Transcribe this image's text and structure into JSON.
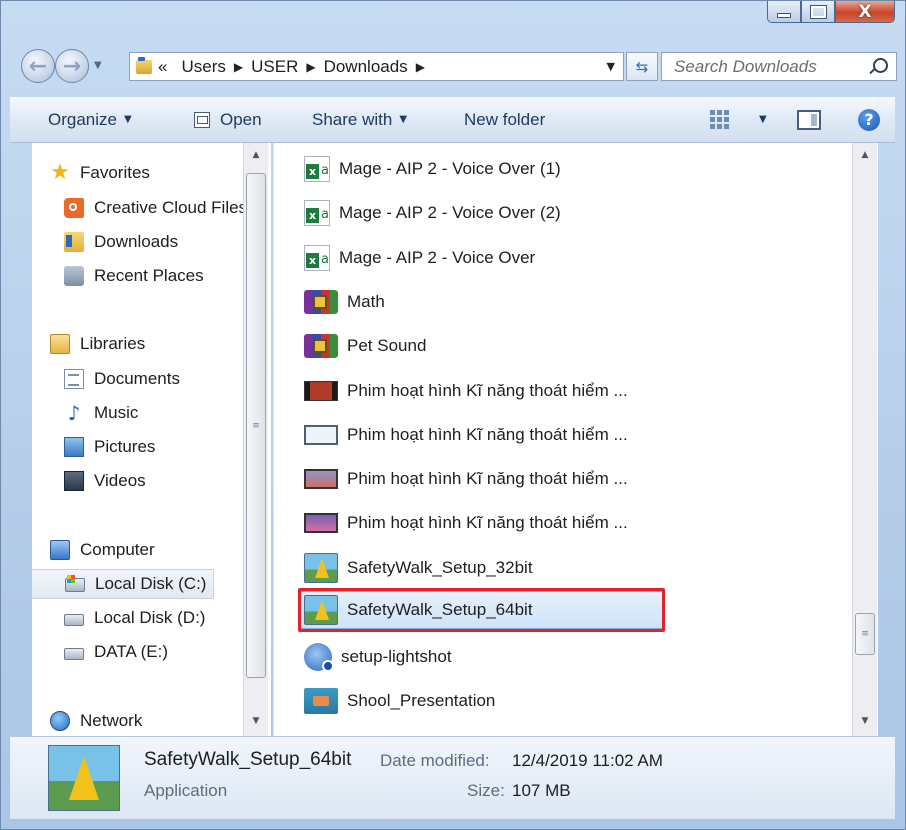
{
  "window": {
    "minimize_icon": "minimize-icon",
    "maximize_icon": "maximize-icon",
    "close_glyph": "X"
  },
  "nav": {
    "back_glyph": "←",
    "forward_glyph": "→",
    "breadcrumb": [
      "«",
      "Users",
      "USER",
      "Downloads"
    ],
    "search_placeholder": "Search Downloads"
  },
  "toolbar": {
    "organize": "Organize",
    "open": "Open",
    "share_with": "Share with",
    "new_folder": "New folder",
    "help_glyph": "?"
  },
  "sidebar": {
    "favorites": {
      "header": "Favorites",
      "items": [
        "Creative Cloud Files",
        "Downloads",
        "Recent Places"
      ]
    },
    "libraries": {
      "header": "Libraries",
      "items": [
        "Documents",
        "Music",
        "Pictures",
        "Videos"
      ]
    },
    "computer": {
      "header": "Computer",
      "items": [
        "Local Disk (C:)",
        "Local Disk (D:)",
        "DATA (E:)"
      ],
      "selected": "Local Disk (C:)"
    },
    "network": {
      "header": "Network"
    }
  },
  "files": [
    {
      "name": "Mage - AIP 2 - Voice Over (1)",
      "icon": "excel-file-icon"
    },
    {
      "name": "Mage - AIP 2 - Voice Over (2)",
      "icon": "excel-file-icon"
    },
    {
      "name": "Mage - AIP 2 - Voice Over",
      "icon": "excel-file-icon"
    },
    {
      "name": "Math",
      "icon": "winrar-archive-icon"
    },
    {
      "name": "Pet Sound",
      "icon": "winrar-archive-icon"
    },
    {
      "name": "Phim hoạt hình Kĩ năng thoát hiểm ...",
      "icon": "video-thumbnail-icon"
    },
    {
      "name": "Phim hoạt hình Kĩ năng thoát hiểm ...",
      "icon": "video-thumbnail-icon"
    },
    {
      "name": "Phim hoạt hình Kĩ năng thoát hiểm ...",
      "icon": "video-thumbnail-icon"
    },
    {
      "name": "Phim hoạt hình Kĩ năng thoát hiểm ...",
      "icon": "video-thumbnail-icon"
    },
    {
      "name": "SafetyWalk_Setup_32bit",
      "icon": "safetywalk-app-icon"
    },
    {
      "name": "SafetyWalk_Setup_64bit",
      "icon": "safetywalk-app-icon",
      "selected": true,
      "highlight_color": "#e4202a"
    },
    {
      "name": "setup-lightshot",
      "icon": "lightshot-setup-icon"
    },
    {
      "name": "Shool_Presentation",
      "icon": "presentation-file-icon"
    }
  ],
  "details": {
    "name": "SafetyWalk_Setup_64bit",
    "type": "Application",
    "date_modified_label": "Date modified:",
    "date_modified": "12/4/2019 11:02 AM",
    "size_label": "Size:",
    "size": "107 MB"
  },
  "colors": {
    "selection_bg": "#cfe3f8",
    "highlight_border": "#e4202a",
    "window_frame": "#b5cde9"
  }
}
